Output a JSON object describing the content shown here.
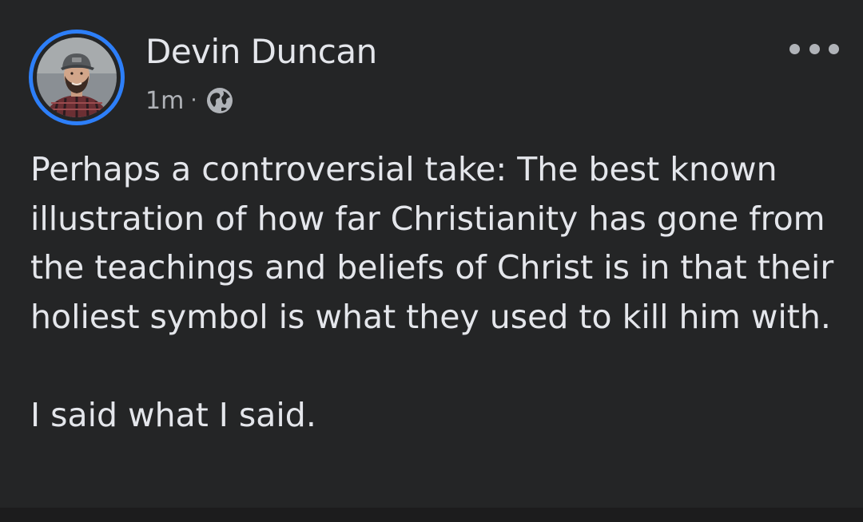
{
  "post": {
    "author": "Devin Duncan",
    "timestamp": "1m",
    "separator": "·",
    "audience_icon": "globe-icon",
    "more_icon": "more-horizontal-icon",
    "avatar_icon": "profile-photo",
    "ring_color": "#2d7ff9",
    "paragraphs": [
      "Perhaps a controversial take: The best known illustration of how far Christianity has gone from the teachings and beliefs of Christ is in that their holiest symbol is what they used to kill him with.",
      "I said what I said."
    ]
  }
}
